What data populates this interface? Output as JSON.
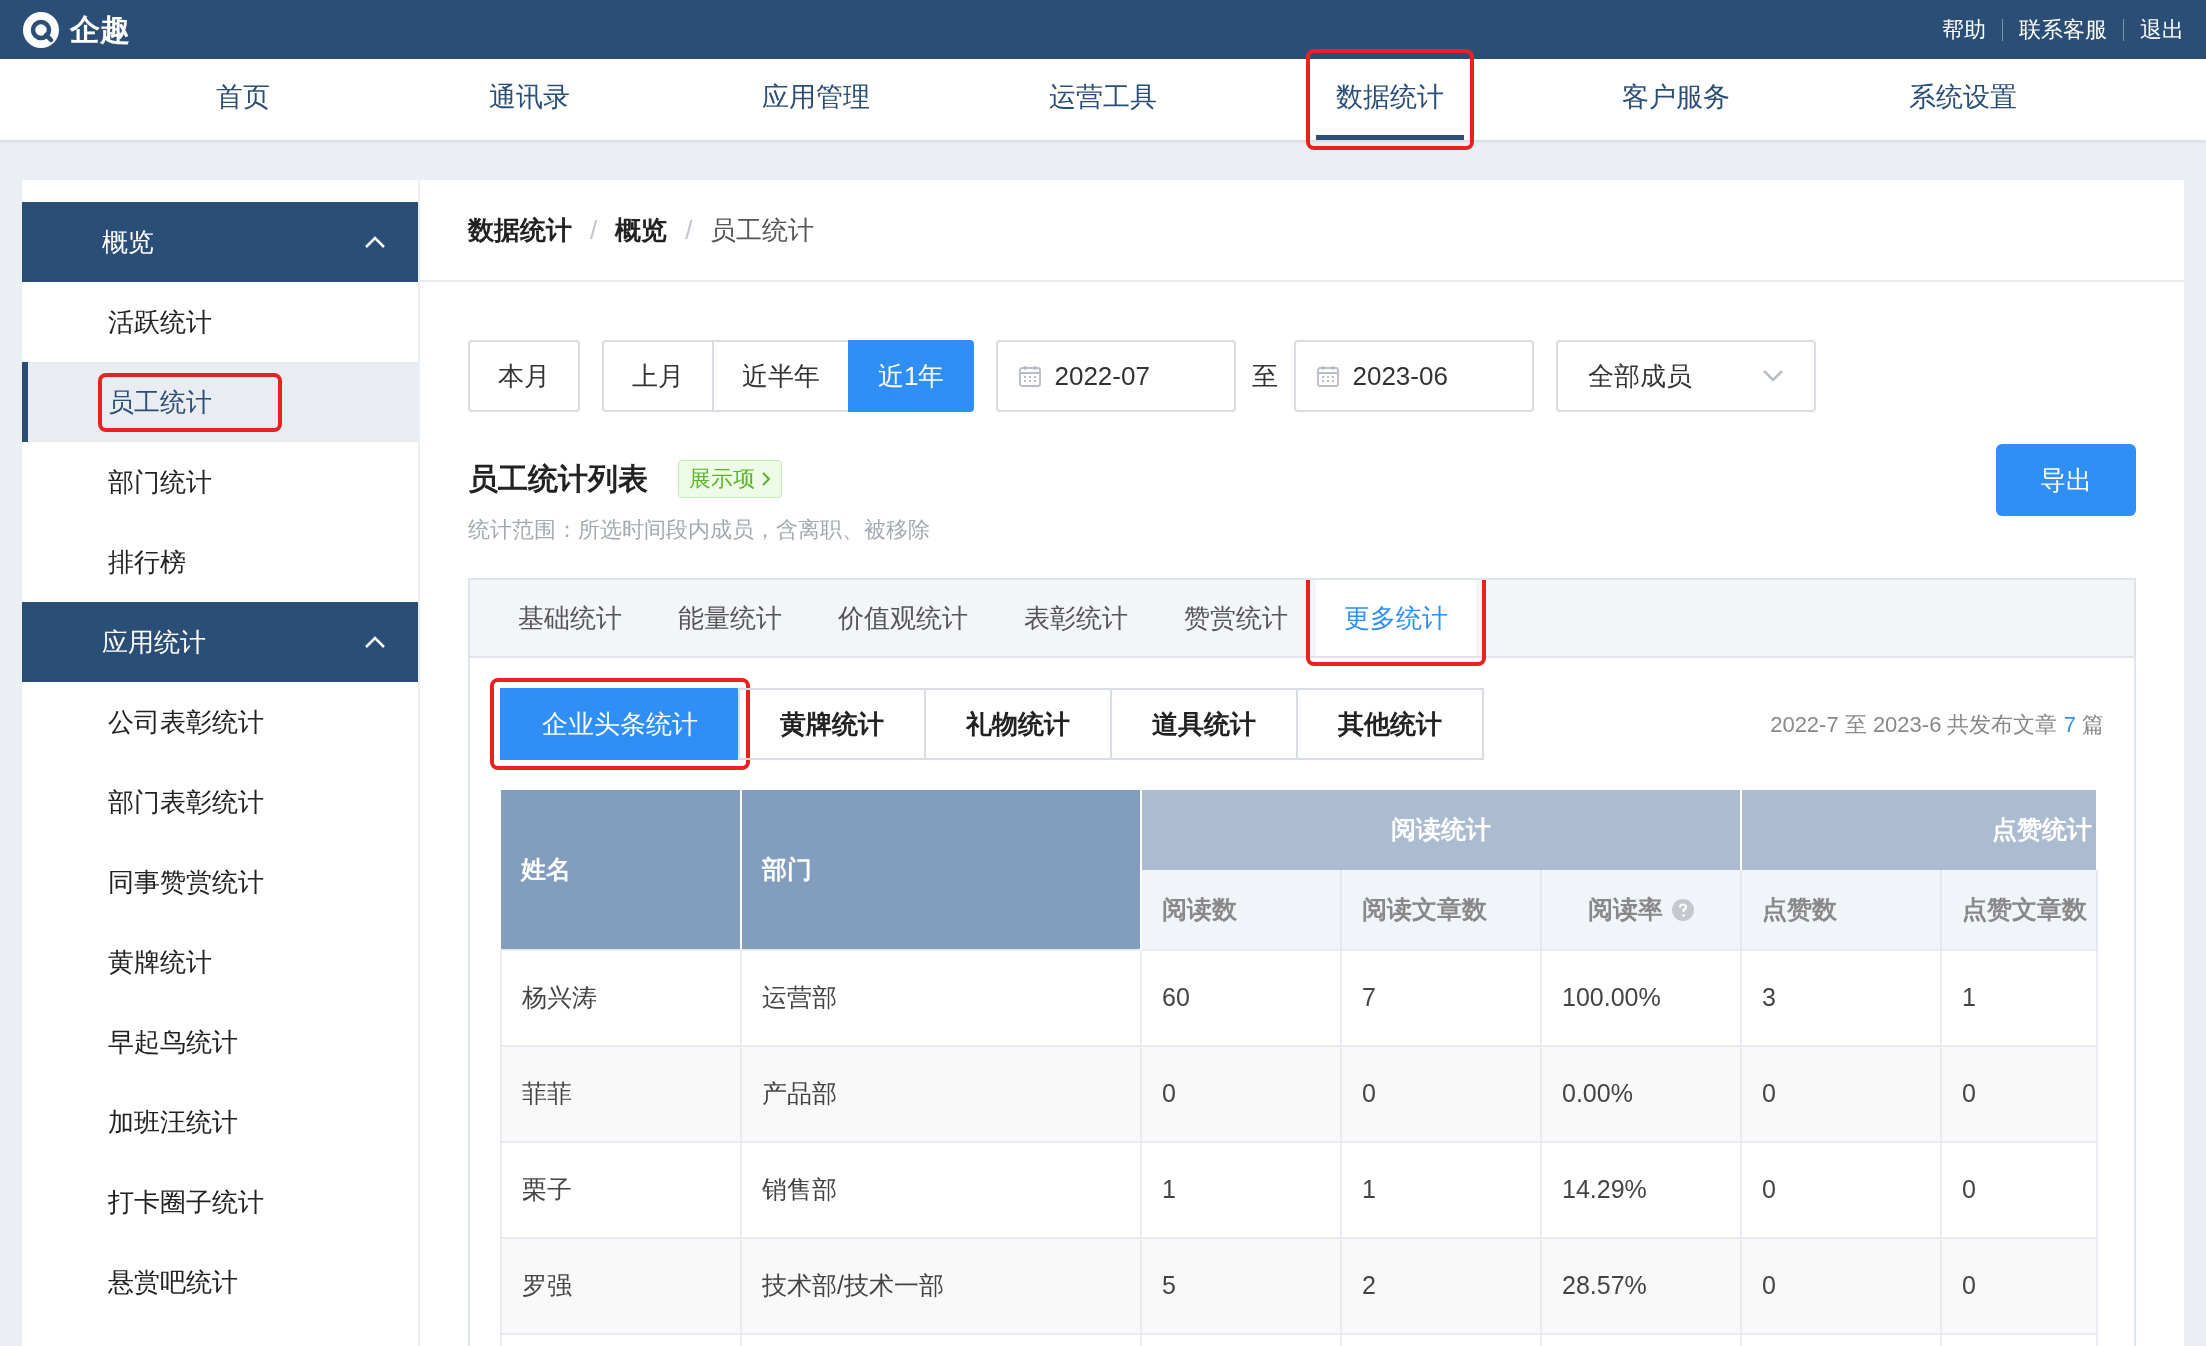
{
  "topbar": {
    "logo_text": "企趣",
    "links": [
      "帮助",
      "联系客服",
      "退出"
    ]
  },
  "nav": [
    {
      "label": "首页",
      "selected": false,
      "highlighted": false
    },
    {
      "label": "通讯录",
      "selected": false,
      "highlighted": false
    },
    {
      "label": "应用管理",
      "selected": false,
      "highlighted": false
    },
    {
      "label": "运营工具",
      "selected": false,
      "highlighted": false
    },
    {
      "label": "数据统计",
      "selected": true,
      "highlighted": true
    },
    {
      "label": "客户服务",
      "selected": false,
      "highlighted": false
    },
    {
      "label": "系统设置",
      "selected": false,
      "highlighted": false
    }
  ],
  "sidebar": [
    {
      "title": "概览",
      "expanded": true,
      "items": [
        {
          "label": "活跃统计",
          "selected": false,
          "highlighted": false
        },
        {
          "label": "员工统计",
          "selected": true,
          "highlighted": true
        },
        {
          "label": "部门统计",
          "selected": false,
          "highlighted": false
        },
        {
          "label": "排行榜",
          "selected": false,
          "highlighted": false
        }
      ]
    },
    {
      "title": "应用统计",
      "expanded": true,
      "items": [
        {
          "label": "公司表彰统计",
          "selected": false,
          "highlighted": false
        },
        {
          "label": "部门表彰统计",
          "selected": false,
          "highlighted": false
        },
        {
          "label": "同事赞赏统计",
          "selected": false,
          "highlighted": false
        },
        {
          "label": "黄牌统计",
          "selected": false,
          "highlighted": false
        },
        {
          "label": "早起鸟统计",
          "selected": false,
          "highlighted": false
        },
        {
          "label": "加班汪统计",
          "selected": false,
          "highlighted": false
        },
        {
          "label": "打卡圈子统计",
          "selected": false,
          "highlighted": false
        },
        {
          "label": "悬赏吧统计",
          "selected": false,
          "highlighted": false
        }
      ]
    }
  ],
  "breadcrumb": [
    "数据统计",
    "概览",
    "员工统计"
  ],
  "breadcrumb_separator": "/",
  "filters": {
    "single": {
      "label": "本月",
      "selected": false
    },
    "ranges": [
      {
        "label": "上月",
        "selected": false
      },
      {
        "label": "近半年",
        "selected": false
      },
      {
        "label": "近1年",
        "selected": true
      }
    ],
    "start_date": "2022-07",
    "separator": "至",
    "end_date": "2023-06",
    "member_select": "全部成员"
  },
  "list_title": "员工统计列表",
  "display_tag": "展示项",
  "scope_note": "统计范围：所选时间段内成员，含离职、被移除",
  "export_button": "导出",
  "tabs": [
    {
      "label": "基础统计",
      "selected": false,
      "highlighted": false
    },
    {
      "label": "能量统计",
      "selected": false,
      "highlighted": false
    },
    {
      "label": "价值观统计",
      "selected": false,
      "highlighted": false
    },
    {
      "label": "表彰统计",
      "selected": false,
      "highlighted": false
    },
    {
      "label": "赞赏统计",
      "selected": false,
      "highlighted": false
    },
    {
      "label": "更多统计",
      "selected": true,
      "highlighted": true
    }
  ],
  "subtabs": [
    {
      "label": "企业头条统计",
      "selected": true,
      "highlighted": true
    },
    {
      "label": "黄牌统计",
      "selected": false,
      "highlighted": false
    },
    {
      "label": "礼物统计",
      "selected": false,
      "highlighted": false
    },
    {
      "label": "道具统计",
      "selected": false,
      "highlighted": false
    },
    {
      "label": "其他统计",
      "selected": false,
      "highlighted": false
    }
  ],
  "summary": {
    "text": "2022-7 至 2023-6 共发布文章",
    "count": "7",
    "unit": "篇"
  },
  "table": {
    "fixed_columns": [
      "姓名",
      "部门"
    ],
    "groups": [
      {
        "title": "阅读统计",
        "columns": [
          "阅读数",
          "阅读文章数",
          "阅读率"
        ]
      },
      {
        "title": "点赞统计",
        "columns": [
          "点赞数",
          "点赞文章数"
        ]
      }
    ],
    "rows": [
      [
        "杨兴涛",
        "运营部",
        "60",
        "7",
        "100.00%",
        "3",
        "1"
      ],
      [
        "菲菲",
        "产品部",
        "0",
        "0",
        "0.00%",
        "0",
        "0"
      ],
      [
        "栗子",
        "销售部",
        "1",
        "1",
        "14.29%",
        "0",
        "0"
      ],
      [
        "罗强",
        "技术部/技术一部",
        "5",
        "2",
        "28.57%",
        "0",
        "0"
      ]
    ]
  }
}
